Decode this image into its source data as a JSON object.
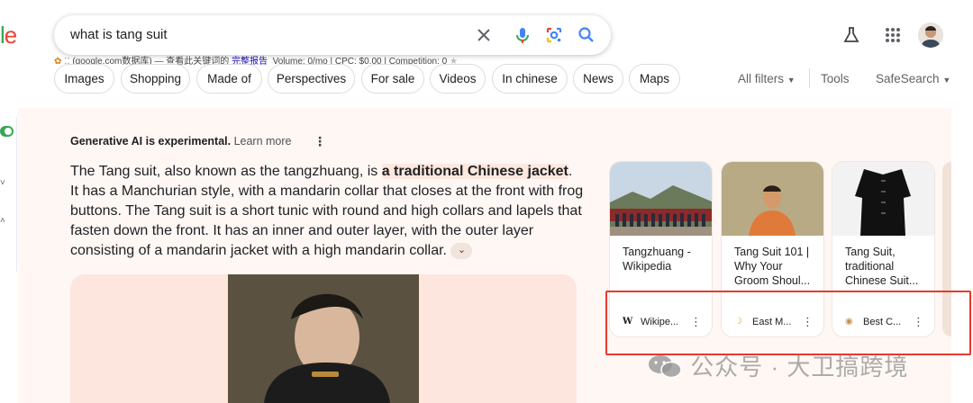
{
  "logo_fragment": {
    "l": "l",
    "e": "e"
  },
  "search": {
    "query": "what is tang suit",
    "clear_icon": "close-icon",
    "mic_icon": "mic-icon",
    "lens_icon": "lens-icon",
    "search_icon": "search-icon"
  },
  "seo_bar": {
    "source": "(google.com数据库) — 查看此关键词的",
    "report_link": "完整报告",
    "metrics": "Volume: 0/mo | CPC: $0.00 | Competition: 0"
  },
  "chips": [
    "Images",
    "Shopping",
    "Made of",
    "Perspectives",
    "For sale",
    "Videos",
    "In chinese",
    "News",
    "Maps"
  ],
  "filters": {
    "all_filters": "All filters",
    "tools": "Tools",
    "safesearch": "SafeSearch"
  },
  "ai_overview": {
    "header": "Generative AI is experimental.",
    "learn_more": "Learn more",
    "text_before": "The Tang suit, also known as the tangzhuang, is ",
    "highlight": "a traditional Chinese jacket",
    "text_after": ". It has a Manchurian style, with a mandarin collar that closes at the front with frog buttons. The Tang suit is a short tunic with round and high collars and lapels that fasten down the front. It has an inner and outer layer, with the outer layer consisting of a mandarin jacket with a high mandarin collar."
  },
  "sources": [
    {
      "title": "Tangzhuang - Wikipedia",
      "site": "Wikipe...",
      "favicon": "W"
    },
    {
      "title": "Tang Suit 101 | Why Your Groom Shoul...",
      "site": "East M...",
      "favicon": "☽"
    },
    {
      "title": "Tang Suit, traditional Chinese Suit...",
      "site": "Best C...",
      "favicon": "◉"
    }
  ],
  "watermark": "公众号 · 大卫搞跨境",
  "colors": {
    "highlight": "#fde8df",
    "panel_bg": "#fff7f4",
    "red_box": "#e8392f",
    "accent_blue": "#1a73e8"
  }
}
